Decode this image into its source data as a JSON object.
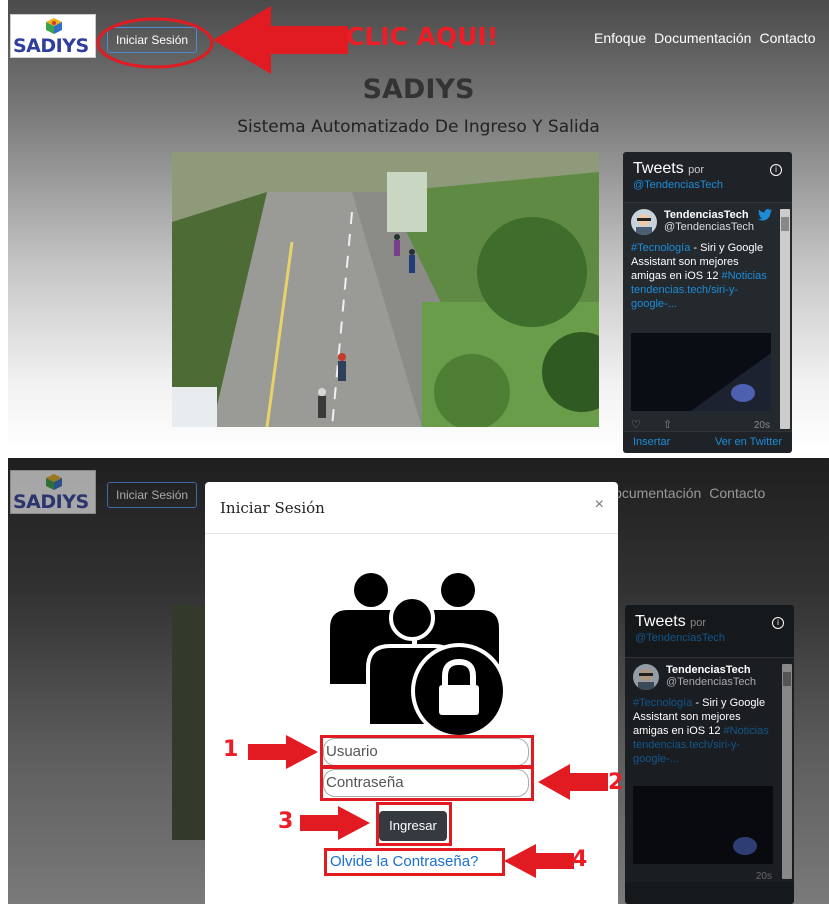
{
  "header": {
    "logo_text": "SADIYS",
    "login_button": "Iniciar Sesión",
    "nav": [
      "Enfoque",
      "Documentación",
      "Contacto"
    ]
  },
  "hero": {
    "title": "SADIYS",
    "subtitle": "Sistema Automatizado De Ingreso Y Salida"
  },
  "annotations": {
    "click_here": "CLIC AQUI!",
    "steps": [
      "1",
      "2",
      "3",
      "4"
    ]
  },
  "twitter": {
    "title": "Tweets",
    "by": "por",
    "account": "@TendenciasTech",
    "user_name": "TendenciasTech",
    "user_handle": "@TendenciasTech",
    "tweet_hashtag": "#Tecnología",
    "tweet_text": " - Siri y Google Assistant son mejores amigas en iOS 12 ",
    "tweet_hashtag2": "#Noticias",
    "tweet_link": "tendencias.tech/siri-y-google-...",
    "time": "20s",
    "embed": "Insertar",
    "view_on": "Ver en Twitter"
  },
  "modal": {
    "title": "Iniciar Sesión",
    "close": "×",
    "username_placeholder": "Usuario",
    "password_placeholder": "Contraseña",
    "submit": "Ingresar",
    "forgot": "Olvide la Contraseña?"
  },
  "colors": {
    "annotation_red": "#e21b22",
    "button_border": "#4e8ad6",
    "twitter_blue": "#1d8cd8"
  }
}
